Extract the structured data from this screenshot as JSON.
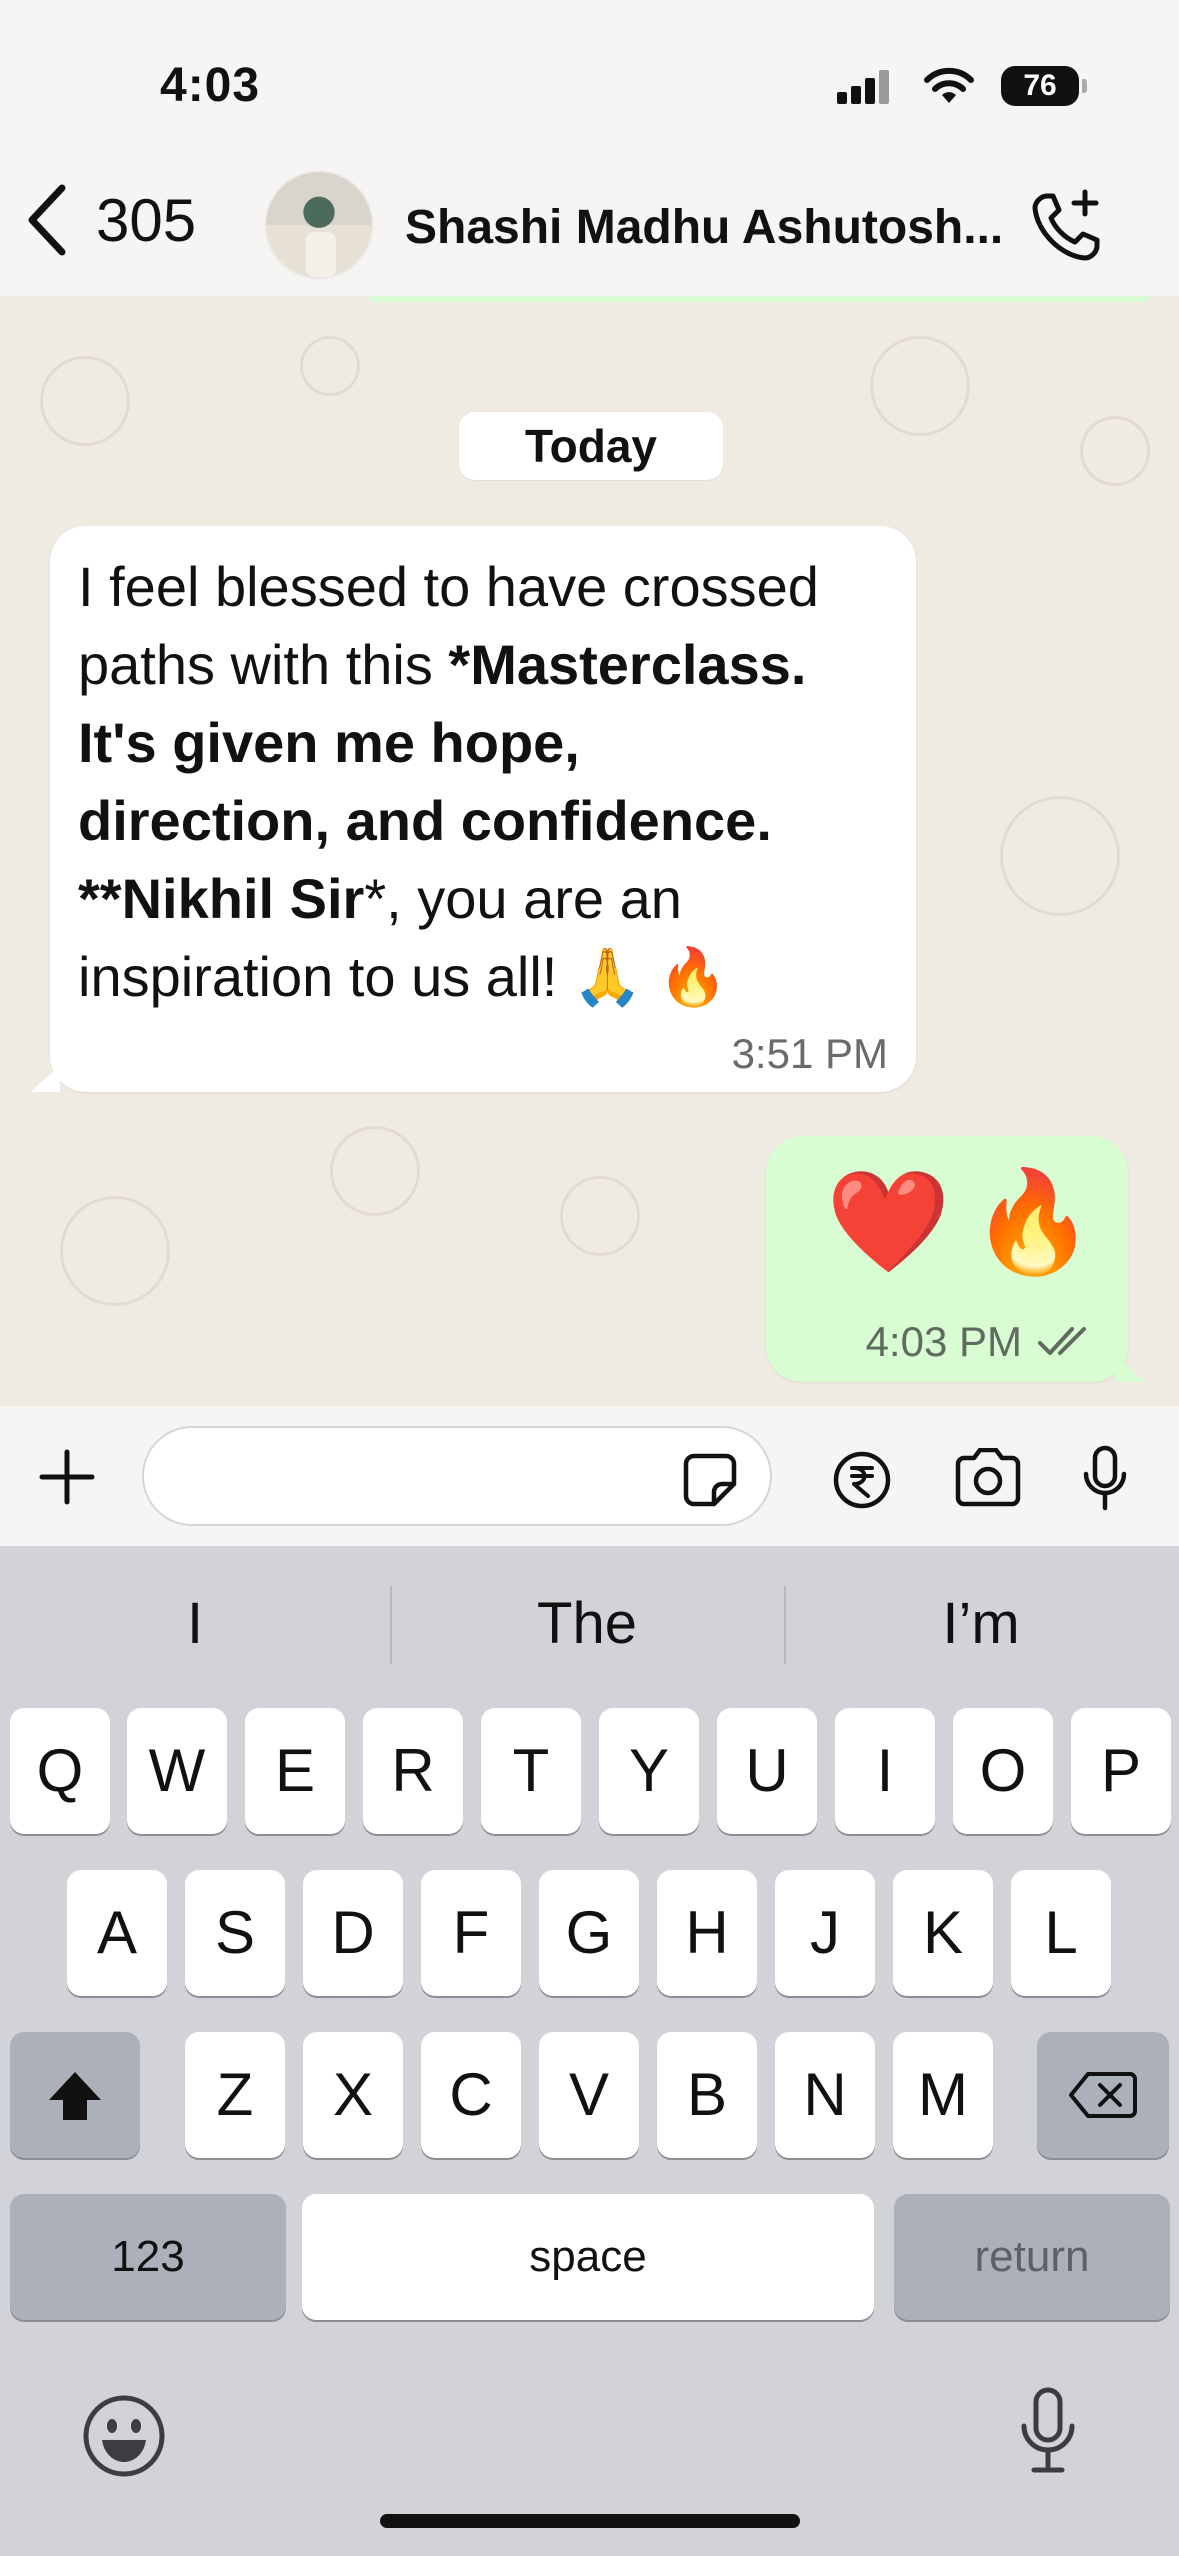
{
  "status_bar": {
    "time": "4:03",
    "battery": "76"
  },
  "header": {
    "back_count": "305",
    "contact_name": "Shashi Madhu Ashutosh..."
  },
  "chat": {
    "date_label": "Today",
    "incoming": {
      "line1": "I feel blessed to have crossed",
      "line2_normal": "paths with this ",
      "line2_bold": "*Masterclass.",
      "line3_bold": "It's given me hope,",
      "line4_bold": "direction, and confidence.",
      "line5_bold": "**Nikhil Sir",
      "line5_normal": "*, you are an",
      "line6": "inspiration to us all! 🙏 🔥",
      "time": "3:51 PM"
    },
    "outgoing": {
      "emoji1": "❤️",
      "emoji2": "🔥",
      "time": "4:03 PM"
    }
  },
  "input_bar": {
    "placeholder": ""
  },
  "keyboard": {
    "suggestions": [
      "I",
      "The",
      "I’m"
    ],
    "row1": [
      "Q",
      "W",
      "E",
      "R",
      "T",
      "Y",
      "U",
      "I",
      "O",
      "P"
    ],
    "row2": [
      "A",
      "S",
      "D",
      "F",
      "G",
      "H",
      "J",
      "K",
      "L"
    ],
    "row3": [
      "Z",
      "X",
      "C",
      "V",
      "B",
      "N",
      "M"
    ],
    "numbers_label": "123",
    "space_label": "space",
    "return_label": "return"
  },
  "colors": {
    "incoming_bubble": "#ffffff",
    "outgoing_bubble": "#d9fdd3",
    "chat_bg": "#efeae2",
    "keyboard_bg": "#d1d3d9"
  }
}
